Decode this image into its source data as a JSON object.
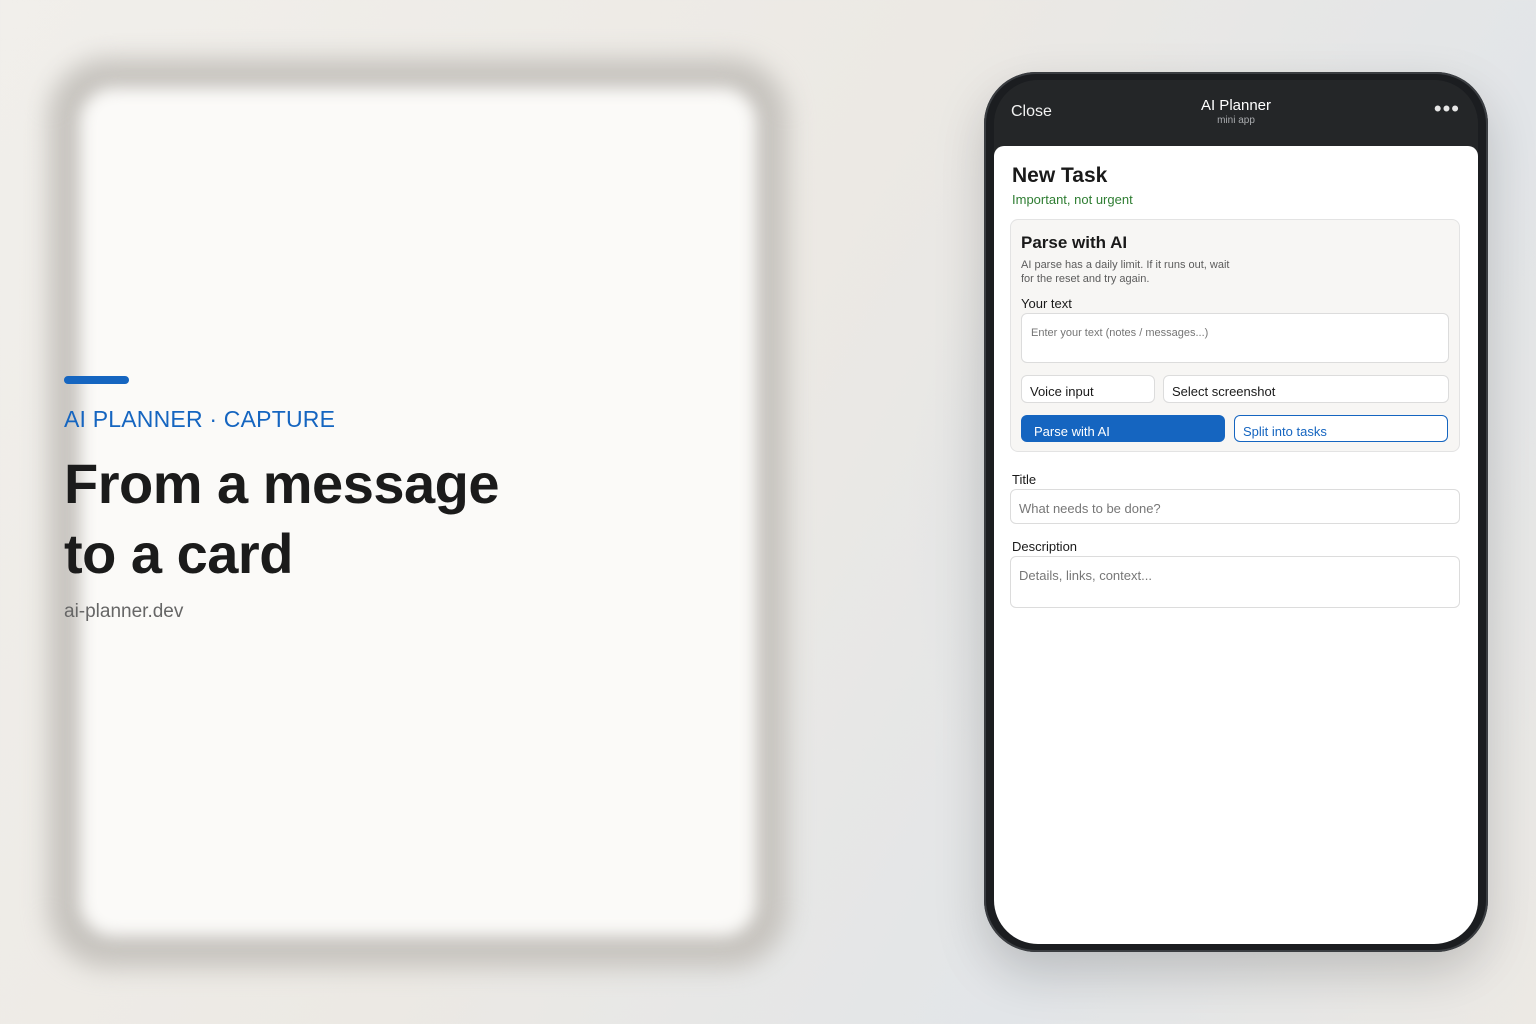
{
  "hero": {
    "kicker": "AI PLANNER · CAPTURE",
    "title_line1": "From a message",
    "title_line2": "to a card",
    "url": "ai-planner.dev"
  },
  "topbar": {
    "close_label": "Close",
    "app_title": "AI Planner",
    "app_subtitle": "mini app",
    "more_label": "•••"
  },
  "task": {
    "title": "New Task",
    "priority": "Important, not urgent"
  },
  "ai_parse": {
    "heading": "Parse with AI",
    "note": "AI parse has a daily limit. If it runs out, wait for the reset and try again.",
    "text_label": "Your text",
    "text_placeholder": "Enter your text (notes / messages...)",
    "voice_label": "Voice input",
    "screenshot_label": "Select screenshot",
    "parse_label": "Parse with AI",
    "split_label": "Split into tasks"
  },
  "form": {
    "title_label": "Title",
    "title_placeholder": "What needs to be done?",
    "description_label": "Description",
    "description_placeholder": "Details, links, context..."
  },
  "colors": {
    "accent": "#1565c0",
    "priority": "#2e7d32",
    "topbar": "#242628"
  }
}
